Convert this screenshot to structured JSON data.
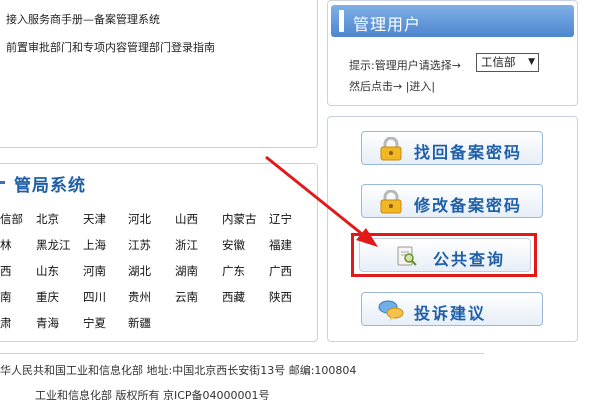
{
  "docs": {
    "items": [
      {
        "label": "接入服务商手册—备案管理系统"
      },
      {
        "label": "前置审批部门和专项内容管理部门登录指南"
      }
    ]
  },
  "bureau": {
    "title": "管局系统",
    "provinces": [
      "信部",
      "北京",
      "天津",
      "河北",
      "山西",
      "内蒙古",
      "辽宁",
      "林",
      "黑龙江",
      "上海",
      "江苏",
      "浙江",
      "安徽",
      "福建",
      "西",
      "山东",
      "河南",
      "湖北",
      "湖南",
      "广东",
      "广西",
      "南",
      "重庆",
      "四川",
      "贵州",
      "云南",
      "西藏",
      "陕西",
      "肃",
      "青海",
      "宁夏",
      "新疆"
    ]
  },
  "admin": {
    "title": "管理用户",
    "prompt": "提示:管理用户请选择→",
    "selected_option": "工信部",
    "click_hint": "然后点击→",
    "enter_label": "|进入|"
  },
  "actions": {
    "recover_password": "找回备案密码",
    "change_password": "修改备案密码",
    "public_query": "公共查询",
    "complaint": "投诉建议"
  },
  "footer": {
    "line1": "华人民共和国工业和信息化部 地址:中国北京西长安街13号 邮编:100804",
    "line2": "工业和信息化部 版权所有 京ICP备04000001号"
  },
  "colors": {
    "accent": "#1f5fa8",
    "header_gradient_top": "#7fb0e6",
    "header_gradient_bottom": "#4d86cf",
    "highlight": "#e21919",
    "arrow": "#e21919"
  }
}
